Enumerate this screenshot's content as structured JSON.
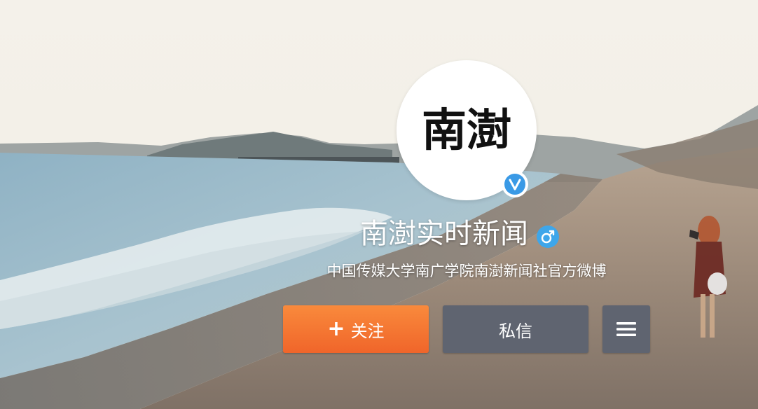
{
  "profile": {
    "avatar_text": "南澍",
    "name": "南澍实时新闻",
    "bio": "中国传媒大学南广学院南澍新闻社官方微博",
    "verified_icon": "verified-v-icon",
    "gender_icon": "male-icon",
    "gender_symbol": "♂"
  },
  "actions": {
    "follow_icon": "+",
    "follow_label": "关注",
    "message_label": "私信",
    "menu_icon": "hamburger-menu-icon"
  },
  "colors": {
    "follow_button": "#f26c2b",
    "secondary_button": "#5f6470",
    "verified_badge": "#3a9ae6",
    "gender_badge": "#3ea6ea"
  }
}
